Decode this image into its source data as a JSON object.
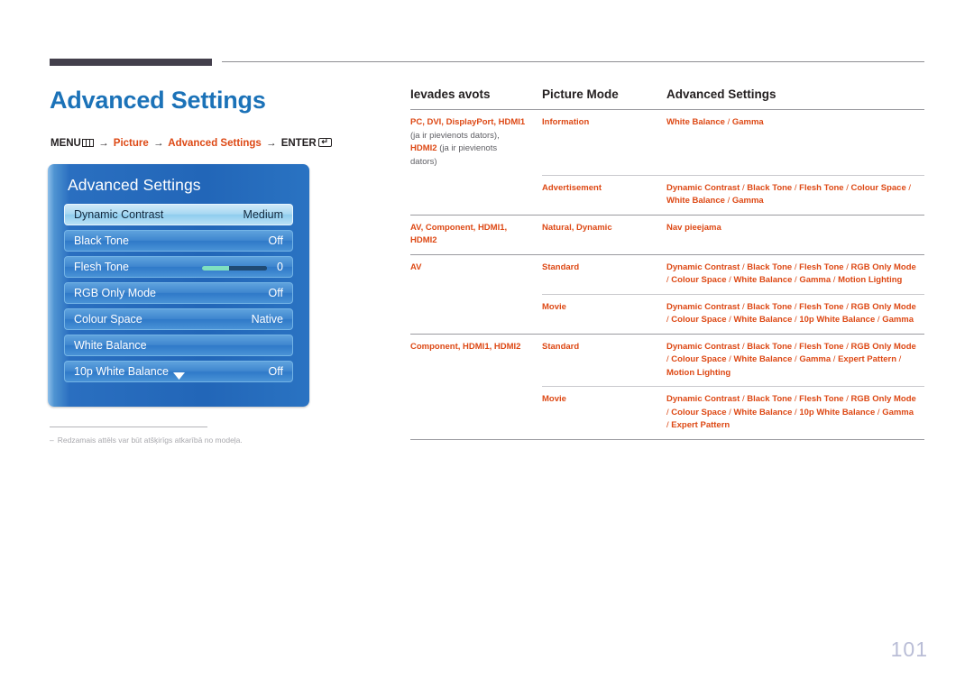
{
  "page": {
    "title": "Advanced Settings",
    "number": "101",
    "title_color": "#1b72b8",
    "accent_color": "#dd4814"
  },
  "breadcrumb": {
    "menu_label": "MENU",
    "menu_icon": "menu-bars-icon",
    "arrow": "→",
    "step1": "Picture",
    "step2": "Advanced Settings",
    "enter_label": "ENTER",
    "enter_icon": "enter-return-icon",
    "enter_glyph": "↵"
  },
  "osd": {
    "title": "Advanced Settings",
    "more_icon": "chevron-down-icon",
    "rows": [
      {
        "label": "Dynamic Contrast",
        "value": "Medium",
        "selected": true,
        "slider": false
      },
      {
        "label": "Black Tone",
        "value": "Off",
        "selected": false,
        "slider": false
      },
      {
        "label": "Flesh Tone",
        "value": "0",
        "selected": false,
        "slider": true
      },
      {
        "label": "RGB Only Mode",
        "value": "Off",
        "selected": false,
        "slider": false
      },
      {
        "label": "Colour Space",
        "value": "Native",
        "selected": false,
        "slider": false
      },
      {
        "label": "White Balance",
        "value": "",
        "selected": false,
        "slider": false
      },
      {
        "label": "10p White Balance",
        "value": "Off",
        "selected": false,
        "slider": false
      }
    ]
  },
  "footnote": {
    "dash": "–",
    "text": "Redzamais attēls var būt atšķirīgs atkarībā no modeļa."
  },
  "table": {
    "headers": [
      "Ievades avots",
      "Picture Mode",
      "Advanced Settings"
    ],
    "rows": [
      {
        "source": "PC, DVI, DisplayPort, HDMI1",
        "source_note1": "(ja ir pievienots dators),",
        "source2": "HDMI2",
        "source_note2": "(ja ir pievienots",
        "source_note3": "dators)",
        "mode": "Information",
        "settings": "White Balance / Gamma",
        "settings_plain": false
      },
      {
        "mode": "Advertisement",
        "settings": "Dynamic Contrast / Black Tone / Flesh Tone / Colour Space / White Balance / Gamma",
        "settings_plain": false
      },
      {
        "source": "AV, Component, HDMI1,",
        "source2": "HDMI2",
        "mode": "Natural, Dynamic",
        "settings": "Nav pieejama",
        "settings_plain": true
      },
      {
        "source": "AV",
        "mode": "Standard",
        "settings": "Dynamic Contrast / Black Tone / Flesh Tone / RGB Only Mode / Colour Space / White Balance / Gamma / Motion Lighting",
        "settings_plain": false
      },
      {
        "mode": "Movie",
        "settings": "Dynamic Contrast / Black Tone / Flesh Tone / RGB Only Mode / Colour Space / White Balance / 10p White Balance / Gamma",
        "settings_plain": false
      },
      {
        "source": "Component, HDMI1, HDMI2",
        "mode": "Standard",
        "settings": "Dynamic Contrast / Black Tone / Flesh Tone / RGB Only Mode / Colour Space / White Balance / Gamma / Expert Pattern / Motion Lighting",
        "settings_plain": false
      },
      {
        "mode": "Movie",
        "settings": "Dynamic Contrast / Black Tone / Flesh Tone / RGB Only Mode / Colour Space / White Balance / 10p White Balance / Gamma / Expert Pattern",
        "settings_plain": false
      }
    ]
  }
}
